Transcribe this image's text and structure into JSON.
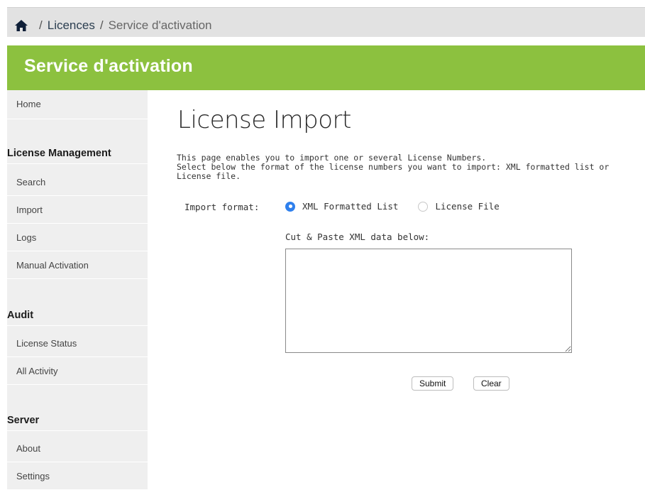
{
  "breadcrumb": {
    "home_icon": "home-icon",
    "items": [
      "Licences",
      "Service d'activation"
    ],
    "separator": "/"
  },
  "banner": {
    "title": "Service d'activation",
    "color": "#8cc13f"
  },
  "sidebar": {
    "home": "Home",
    "sections": [
      {
        "heading": "License Management",
        "items": [
          "Search",
          "Import",
          "Logs",
          "Manual Activation"
        ]
      },
      {
        "heading": "Audit",
        "items": [
          "License Status",
          "All Activity"
        ]
      },
      {
        "heading": "Server",
        "items": [
          "About",
          "Settings"
        ]
      }
    ]
  },
  "main": {
    "title": "License Import",
    "intro_line1": "This page enables you to import one or several License Numbers.",
    "intro_line2": "Select below the format of the license numbers you want to import: XML formatted list or License file.",
    "import_format_label": "Import format:",
    "format_options": [
      {
        "label": "XML Formatted List",
        "selected": true
      },
      {
        "label": "License File",
        "selected": false
      }
    ],
    "paste_label": "Cut & Paste XML data below:",
    "xml_value": "",
    "submit_label": "Submit",
    "clear_label": "Clear"
  }
}
